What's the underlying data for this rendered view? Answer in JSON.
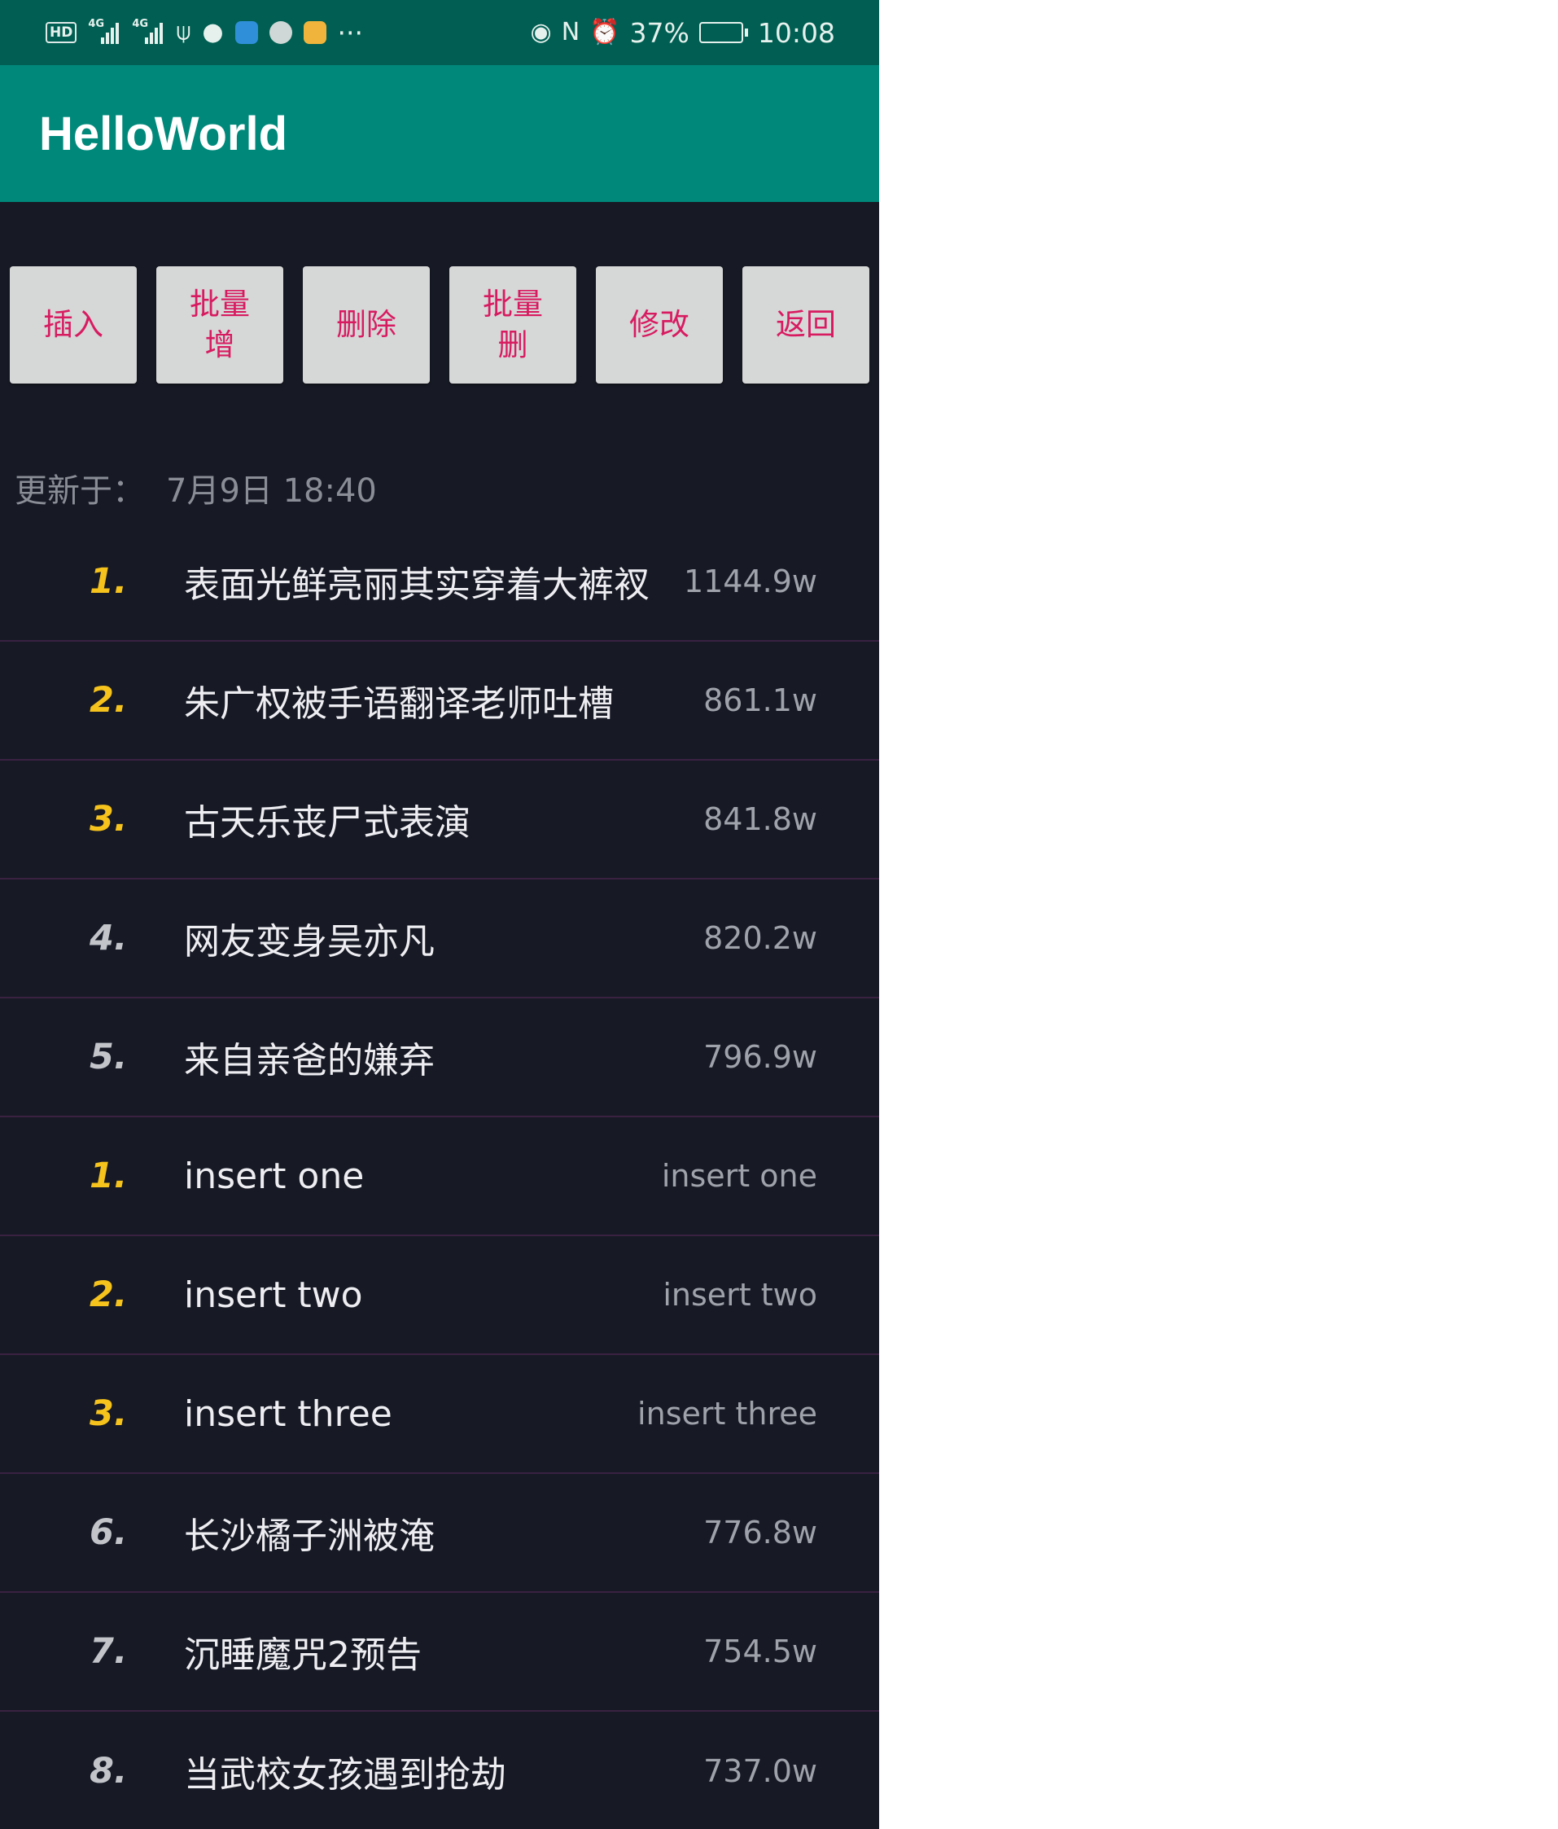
{
  "status_bar": {
    "hd": "HD",
    "net1": "4G",
    "net2": "4G",
    "battery_pct": "37%",
    "battery_level": 0.37,
    "time": "10:08",
    "more": "···",
    "icons": [
      "usb-icon",
      "wechat-icon",
      "app-icon",
      "app-icon",
      "app-icon",
      "eye-icon",
      "nfc-icon",
      "alarm-icon",
      "battery-icon"
    ]
  },
  "app_bar": {
    "title": "HelloWorld"
  },
  "buttons": [
    {
      "label": "插入"
    },
    {
      "label": "批量增"
    },
    {
      "label": "删除"
    },
    {
      "label": "批量删"
    },
    {
      "label": "修改"
    },
    {
      "label": "返回"
    }
  ],
  "updated": {
    "label": "更新于：",
    "time": "7月9日 18:40"
  },
  "list": [
    {
      "rank": "1.",
      "title": "表面光鲜亮丽其实穿着大裤衩",
      "count": "1144.9w",
      "hot": true
    },
    {
      "rank": "2.",
      "title": "朱广权被手语翻译老师吐槽",
      "count": "861.1w",
      "hot": true
    },
    {
      "rank": "3.",
      "title": "古天乐丧尸式表演",
      "count": "841.8w",
      "hot": true
    },
    {
      "rank": "4.",
      "title": "网友变身吴亦凡",
      "count": "820.2w",
      "hot": false
    },
    {
      "rank": "5.",
      "title": "来自亲爸的嫌弃",
      "count": "796.9w",
      "hot": false
    },
    {
      "rank": "1.",
      "title": "insert one",
      "count": "insert one",
      "hot": true
    },
    {
      "rank": "2.",
      "title": "insert two",
      "count": "insert two",
      "hot": true
    },
    {
      "rank": "3.",
      "title": "insert three",
      "count": "insert three",
      "hot": true
    },
    {
      "rank": "6.",
      "title": "长沙橘子洲被淹",
      "count": "776.8w",
      "hot": false
    },
    {
      "rank": "7.",
      "title": "沉睡魔咒2预告",
      "count": "754.5w",
      "hot": false
    },
    {
      "rank": "8.",
      "title": "当武校女孩遇到抢劫",
      "count": "737.0w",
      "hot": false
    }
  ],
  "colors": {
    "status_bar": "#005f52",
    "app_bar": "#00897b",
    "background": "#171a25",
    "button_text": "#d81b60",
    "rank_hot": "#f6c21c",
    "rank_cold": "#c2c4ca",
    "divider": "#3a2142"
  }
}
